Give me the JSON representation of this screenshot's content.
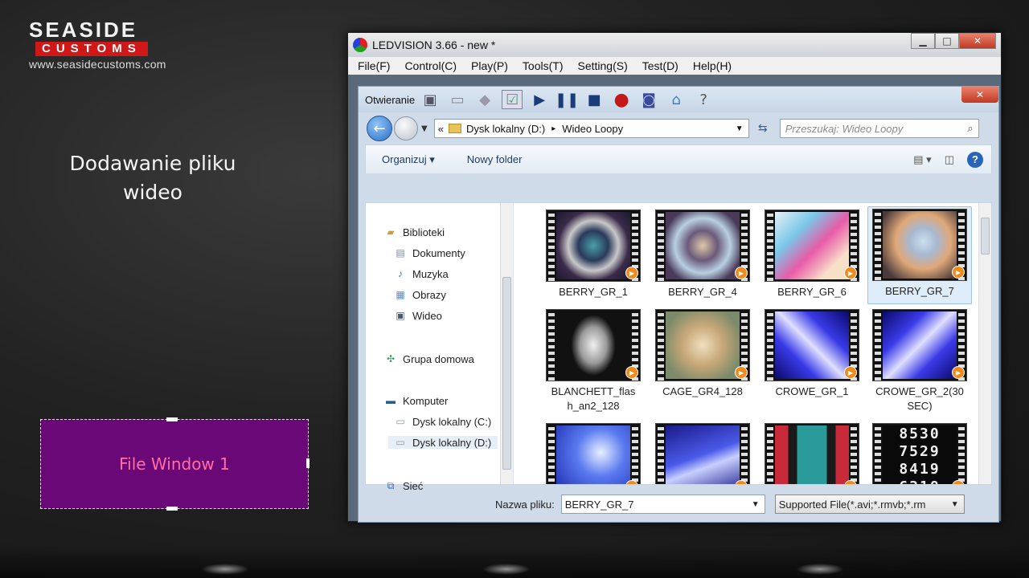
{
  "logo": {
    "line1": "SEASIDE",
    "line2": "CUSTOMS",
    "url": "www.seasidecustoms.com"
  },
  "caption": {
    "line1": "Dodawanie pliku",
    "line2": "wideo"
  },
  "file_window": {
    "label": "File Window 1",
    "color": "#6a0878"
  },
  "app": {
    "title": "LEDVISION 3.66 - new *",
    "menu": [
      "File(F)",
      "Control(C)",
      "Play(P)",
      "Tools(T)",
      "Setting(S)",
      "Test(D)",
      "Help(H)"
    ]
  },
  "dialog": {
    "title": "Otwieranie",
    "address": {
      "prefix": "«",
      "part1": "Dysk lokalny (D:)",
      "sep": "▸",
      "part2": "Wideo Loopy"
    },
    "search_placeholder": "Przeszukaj: Wideo Loopy",
    "toolbar": {
      "organize": "Organizuj",
      "new_folder": "Nowy folder"
    },
    "nav": {
      "libraries": "Biblioteki",
      "documents": "Dokumenty",
      "music": "Muzyka",
      "pictures": "Obrazy",
      "video": "Wideo",
      "homegroup": "Grupa domowa",
      "computer": "Komputer",
      "drive_c": "Dysk lokalny (C:)",
      "drive_d": "Dysk lokalny (D:)",
      "network": "Sieć"
    },
    "files": [
      {
        "name": "BERRY_GR_1"
      },
      {
        "name": "BERRY_GR_4"
      },
      {
        "name": "BERRY_GR_6"
      },
      {
        "name": "BERRY_GR_7",
        "selected": true
      },
      {
        "name": "BLANCHETT_flash_an2_128",
        "l1": "BLANCHETT_flas",
        "l2": "h_an2_128"
      },
      {
        "name": "CAGE_GR4_128"
      },
      {
        "name": "CROWE_GR_1"
      },
      {
        "name": "CROWE_GR_2(30 SEC)",
        "l1": "CROWE_GR_2(30",
        "l2": "SEC)"
      },
      {
        "name": ""
      },
      {
        "name": ""
      },
      {
        "name": ""
      },
      {
        "name": ""
      }
    ],
    "filename_label": "Nazwa pliku:",
    "filename_value": "BERRY_GR_7",
    "filetype_value": "Supported File(*.avi;*.rmvb;*.rm"
  }
}
